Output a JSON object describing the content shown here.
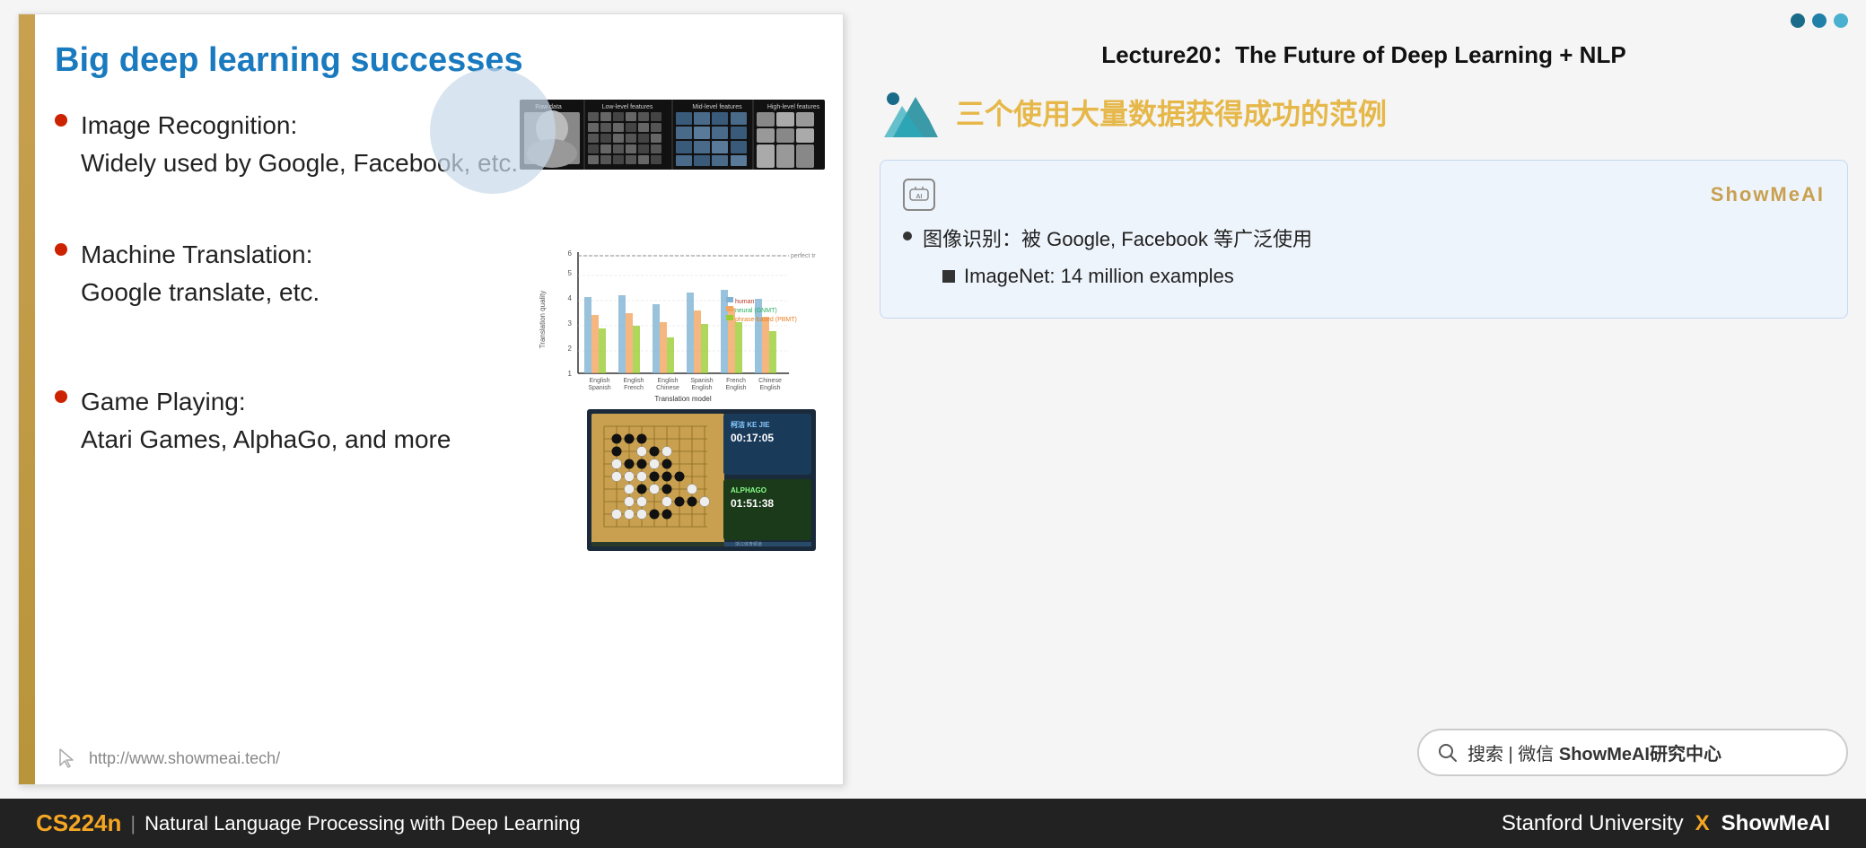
{
  "slide": {
    "title": "Big deep learning successes",
    "left_bar_color": "#c8a050",
    "bullets": [
      {
        "label": "Image Recognition:",
        "detail": "Widely used by Google, Facebook, etc."
      },
      {
        "label": "Machine Translation:",
        "detail": "Google translate, etc."
      },
      {
        "label": "Game Playing:",
        "detail": "Atari Games, AlphaGo, and more"
      }
    ],
    "footer_url": "http://www.showmeai.tech/"
  },
  "right_panel": {
    "lecture_title": "Lecture20：The Future of Deep Learning + NLP",
    "zh_title": "三个使用大量数据获得成功的范例",
    "dots": [
      {
        "color": "#1a6a8a"
      },
      {
        "color": "#2080a8"
      },
      {
        "color": "#4ab0d0"
      }
    ],
    "annotation": {
      "brand": "ShowMeAI",
      "bullets": [
        {
          "text": "图像识别：被 Google, Facebook 等广泛使用",
          "sub": "ImageNet: 14 million examples"
        }
      ]
    },
    "search_label": "搜索 | 微信 ShowMeAI研究中心"
  },
  "bottom_bar": {
    "course_code": "CS224n",
    "pipe": "|",
    "course_name": "Natural Language Processing with Deep Learning",
    "university": "Stanford University",
    "x_label": "X",
    "brand": "ShowMeAI"
  }
}
